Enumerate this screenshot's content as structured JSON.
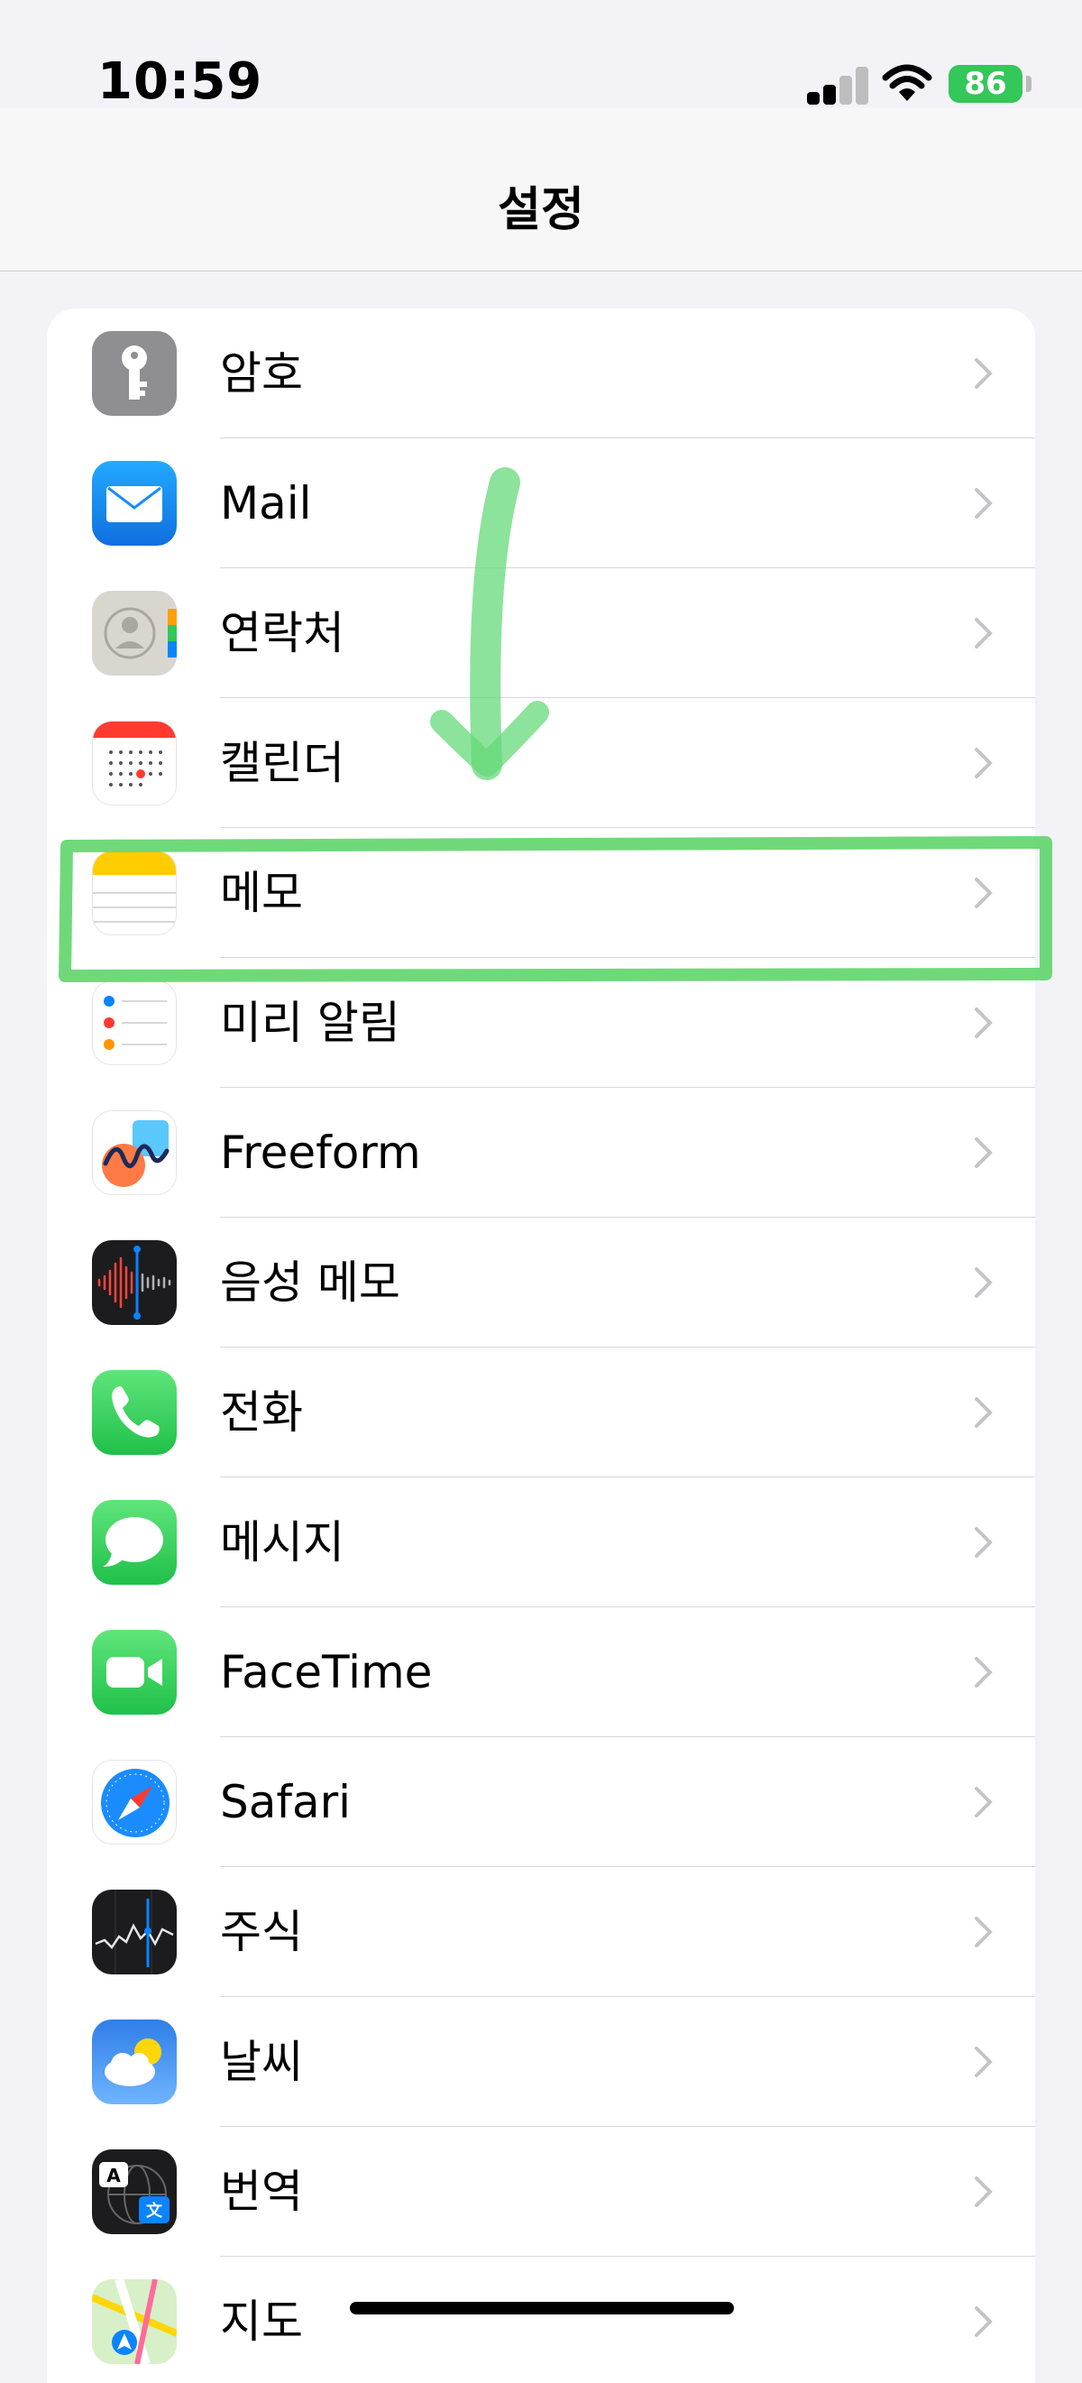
{
  "status_bar": {
    "time": "10:59",
    "battery": "86"
  },
  "header": {
    "title": "설정"
  },
  "settings_items": [
    {
      "label": "암호",
      "icon": "key-icon"
    },
    {
      "label": "Mail",
      "icon": "mail-icon"
    },
    {
      "label": "연락처",
      "icon": "contacts-icon"
    },
    {
      "label": "캘린더",
      "icon": "calendar-icon"
    },
    {
      "label": "메모",
      "icon": "notes-icon"
    },
    {
      "label": "미리 알림",
      "icon": "reminders-icon"
    },
    {
      "label": "Freeform",
      "icon": "freeform-icon"
    },
    {
      "label": "음성 메모",
      "icon": "voice-memos-icon"
    },
    {
      "label": "전화",
      "icon": "phone-icon"
    },
    {
      "label": "메시지",
      "icon": "messages-icon"
    },
    {
      "label": "FaceTime",
      "icon": "facetime-icon"
    },
    {
      "label": "Safari",
      "icon": "safari-icon"
    },
    {
      "label": "주식",
      "icon": "stocks-icon"
    },
    {
      "label": "날씨",
      "icon": "weather-icon"
    },
    {
      "label": "번역",
      "icon": "translate-icon"
    },
    {
      "label": "지도",
      "icon": "maps-icon"
    }
  ],
  "colors": {
    "highlight": "#5fd56a",
    "battery": "#34c759",
    "phone_green": "#34c759",
    "mail_blue": "#1a8cff"
  }
}
